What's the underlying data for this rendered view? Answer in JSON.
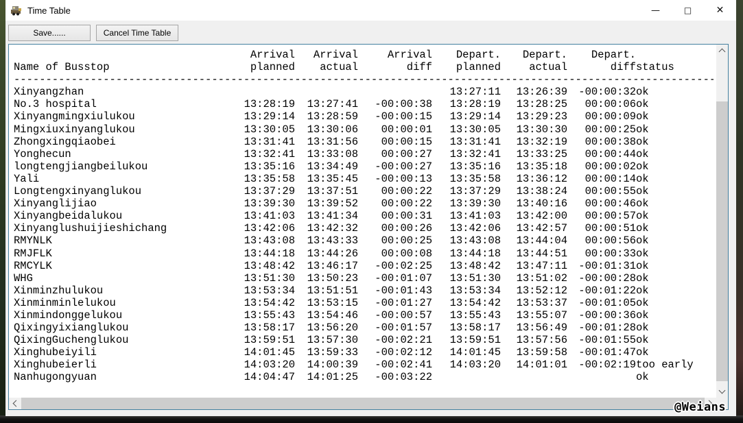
{
  "window": {
    "title": "Time Table",
    "controls": {
      "minimize": "—",
      "maximize": "□",
      "close": "✕"
    }
  },
  "toolbar": {
    "save": "Save......",
    "cancel": "Cancel Time Table"
  },
  "colors": {
    "listbox_border": "#44809f",
    "titlebar_bg": "#ffffff",
    "window_bg": "#f0f0f0",
    "scroll_thumb": "#cdcdcd"
  },
  "table": {
    "header": {
      "line1": [
        "",
        "Arrival",
        "Arrival",
        "Arrival",
        "Depart.",
        "Depart.",
        "Depart.",
        ""
      ],
      "line2": [
        "Name of Busstop",
        "planned",
        "actual",
        "diff",
        "planned",
        "actual",
        "diff",
        "status"
      ]
    },
    "separator": "--------------------------------------------------------------------------------------------------------------",
    "rows": [
      {
        "name": "Xinyangzhan",
        "arr_planned": "",
        "arr_actual": "",
        "arr_diff": "",
        "dep_planned": "13:27:11",
        "dep_actual": "13:26:39",
        "dep_diff": "-00:00:32",
        "status": "ok"
      },
      {
        "name": "No.3 hospital",
        "arr_planned": "13:28:19",
        "arr_actual": "13:27:41",
        "arr_diff": "-00:00:38",
        "dep_planned": "13:28:19",
        "dep_actual": "13:28:25",
        "dep_diff": "00:00:06",
        "status": "ok"
      },
      {
        "name": "Xinyangmingxiulukou",
        "arr_planned": "13:29:14",
        "arr_actual": "13:28:59",
        "arr_diff": "-00:00:15",
        "dep_planned": "13:29:14",
        "dep_actual": "13:29:23",
        "dep_diff": "00:00:09",
        "status": "ok"
      },
      {
        "name": "Mingxiuxinyanglukou",
        "arr_planned": "13:30:05",
        "arr_actual": "13:30:06",
        "arr_diff": "00:00:01",
        "dep_planned": "13:30:05",
        "dep_actual": "13:30:30",
        "dep_diff": "00:00:25",
        "status": "ok"
      },
      {
        "name": "Zhongxingqiaobei",
        "arr_planned": "13:31:41",
        "arr_actual": "13:31:56",
        "arr_diff": "00:00:15",
        "dep_planned": "13:31:41",
        "dep_actual": "13:32:19",
        "dep_diff": "00:00:38",
        "status": "ok"
      },
      {
        "name": "Yonghecun",
        "arr_planned": "13:32:41",
        "arr_actual": "13:33:08",
        "arr_diff": "00:00:27",
        "dep_planned": "13:32:41",
        "dep_actual": "13:33:25",
        "dep_diff": "00:00:44",
        "status": "ok"
      },
      {
        "name": "longtengjiangbeilukou",
        "arr_planned": "13:35:16",
        "arr_actual": "13:34:49",
        "arr_diff": "-00:00:27",
        "dep_planned": "13:35:16",
        "dep_actual": "13:35:18",
        "dep_diff": "00:00:02",
        "status": "ok"
      },
      {
        "name": "Yali",
        "arr_planned": "13:35:58",
        "arr_actual": "13:35:45",
        "arr_diff": "-00:00:13",
        "dep_planned": "13:35:58",
        "dep_actual": "13:36:12",
        "dep_diff": "00:00:14",
        "status": "ok"
      },
      {
        "name": "Longtengxinyanglukou",
        "arr_planned": "13:37:29",
        "arr_actual": "13:37:51",
        "arr_diff": "00:00:22",
        "dep_planned": "13:37:29",
        "dep_actual": "13:38:24",
        "dep_diff": "00:00:55",
        "status": "ok"
      },
      {
        "name": "Xinyanglijiao",
        "arr_planned": "13:39:30",
        "arr_actual": "13:39:52",
        "arr_diff": "00:00:22",
        "dep_planned": "13:39:30",
        "dep_actual": "13:40:16",
        "dep_diff": "00:00:46",
        "status": "ok"
      },
      {
        "name": "Xinyangbeidalukou",
        "arr_planned": "13:41:03",
        "arr_actual": "13:41:34",
        "arr_diff": "00:00:31",
        "dep_planned": "13:41:03",
        "dep_actual": "13:42:00",
        "dep_diff": "00:00:57",
        "status": "ok"
      },
      {
        "name": "Xinyanglushuijieshichang",
        "arr_planned": "13:42:06",
        "arr_actual": "13:42:32",
        "arr_diff": "00:00:26",
        "dep_planned": "13:42:06",
        "dep_actual": "13:42:57",
        "dep_diff": "00:00:51",
        "status": "ok"
      },
      {
        "name": "RMYNLK",
        "arr_planned": "13:43:08",
        "arr_actual": "13:43:33",
        "arr_diff": "00:00:25",
        "dep_planned": "13:43:08",
        "dep_actual": "13:44:04",
        "dep_diff": "00:00:56",
        "status": "ok"
      },
      {
        "name": "RMJFLK",
        "arr_planned": "13:44:18",
        "arr_actual": "13:44:26",
        "arr_diff": "00:00:08",
        "dep_planned": "13:44:18",
        "dep_actual": "13:44:51",
        "dep_diff": "00:00:33",
        "status": "ok"
      },
      {
        "name": "RMCYLK",
        "arr_planned": "13:48:42",
        "arr_actual": "13:46:17",
        "arr_diff": "-00:02:25",
        "dep_planned": "13:48:42",
        "dep_actual": "13:47:11",
        "dep_diff": "-00:01:31",
        "status": "ok"
      },
      {
        "name": "WHG",
        "arr_planned": "13:51:30",
        "arr_actual": "13:50:23",
        "arr_diff": "-00:01:07",
        "dep_planned": "13:51:30",
        "dep_actual": "13:51:02",
        "dep_diff": "-00:00:28",
        "status": "ok"
      },
      {
        "name": "Xinminzhulukou",
        "arr_planned": "13:53:34",
        "arr_actual": "13:51:51",
        "arr_diff": "-00:01:43",
        "dep_planned": "13:53:34",
        "dep_actual": "13:52:12",
        "dep_diff": "-00:01:22",
        "status": "ok"
      },
      {
        "name": "Xinminminlelukou",
        "arr_planned": "13:54:42",
        "arr_actual": "13:53:15",
        "arr_diff": "-00:01:27",
        "dep_planned": "13:54:42",
        "dep_actual": "13:53:37",
        "dep_diff": "-00:01:05",
        "status": "ok"
      },
      {
        "name": "Xinmindonggelukou",
        "arr_planned": "13:55:43",
        "arr_actual": "13:54:46",
        "arr_diff": "-00:00:57",
        "dep_planned": "13:55:43",
        "dep_actual": "13:55:07",
        "dep_diff": "-00:00:36",
        "status": "ok"
      },
      {
        "name": "Qixingyixianglukou",
        "arr_planned": "13:58:17",
        "arr_actual": "13:56:20",
        "arr_diff": "-00:01:57",
        "dep_planned": "13:58:17",
        "dep_actual": "13:56:49",
        "dep_diff": "-00:01:28",
        "status": "ok"
      },
      {
        "name": "QixingGuchenglukou",
        "arr_planned": "13:59:51",
        "arr_actual": "13:57:30",
        "arr_diff": "-00:02:21",
        "dep_planned": "13:59:51",
        "dep_actual": "13:57:56",
        "dep_diff": "-00:01:55",
        "status": "ok"
      },
      {
        "name": "Xinghubeiyili",
        "arr_planned": "14:01:45",
        "arr_actual": "13:59:33",
        "arr_diff": "-00:02:12",
        "dep_planned": "14:01:45",
        "dep_actual": "13:59:58",
        "dep_diff": "-00:01:47",
        "status": "ok"
      },
      {
        "name": "Xinghubeierli",
        "arr_planned": "14:03:20",
        "arr_actual": "14:00:39",
        "arr_diff": "-00:02:41",
        "dep_planned": "14:03:20",
        "dep_actual": "14:01:01",
        "dep_diff": "-00:02:19",
        "status": "too early"
      },
      {
        "name": "Nanhugongyuan",
        "arr_planned": "14:04:47",
        "arr_actual": "14:01:25",
        "arr_diff": "-00:03:22",
        "dep_planned": "",
        "dep_actual": "",
        "dep_diff": "",
        "status": "ok"
      }
    ]
  },
  "watermark": "@Weians"
}
